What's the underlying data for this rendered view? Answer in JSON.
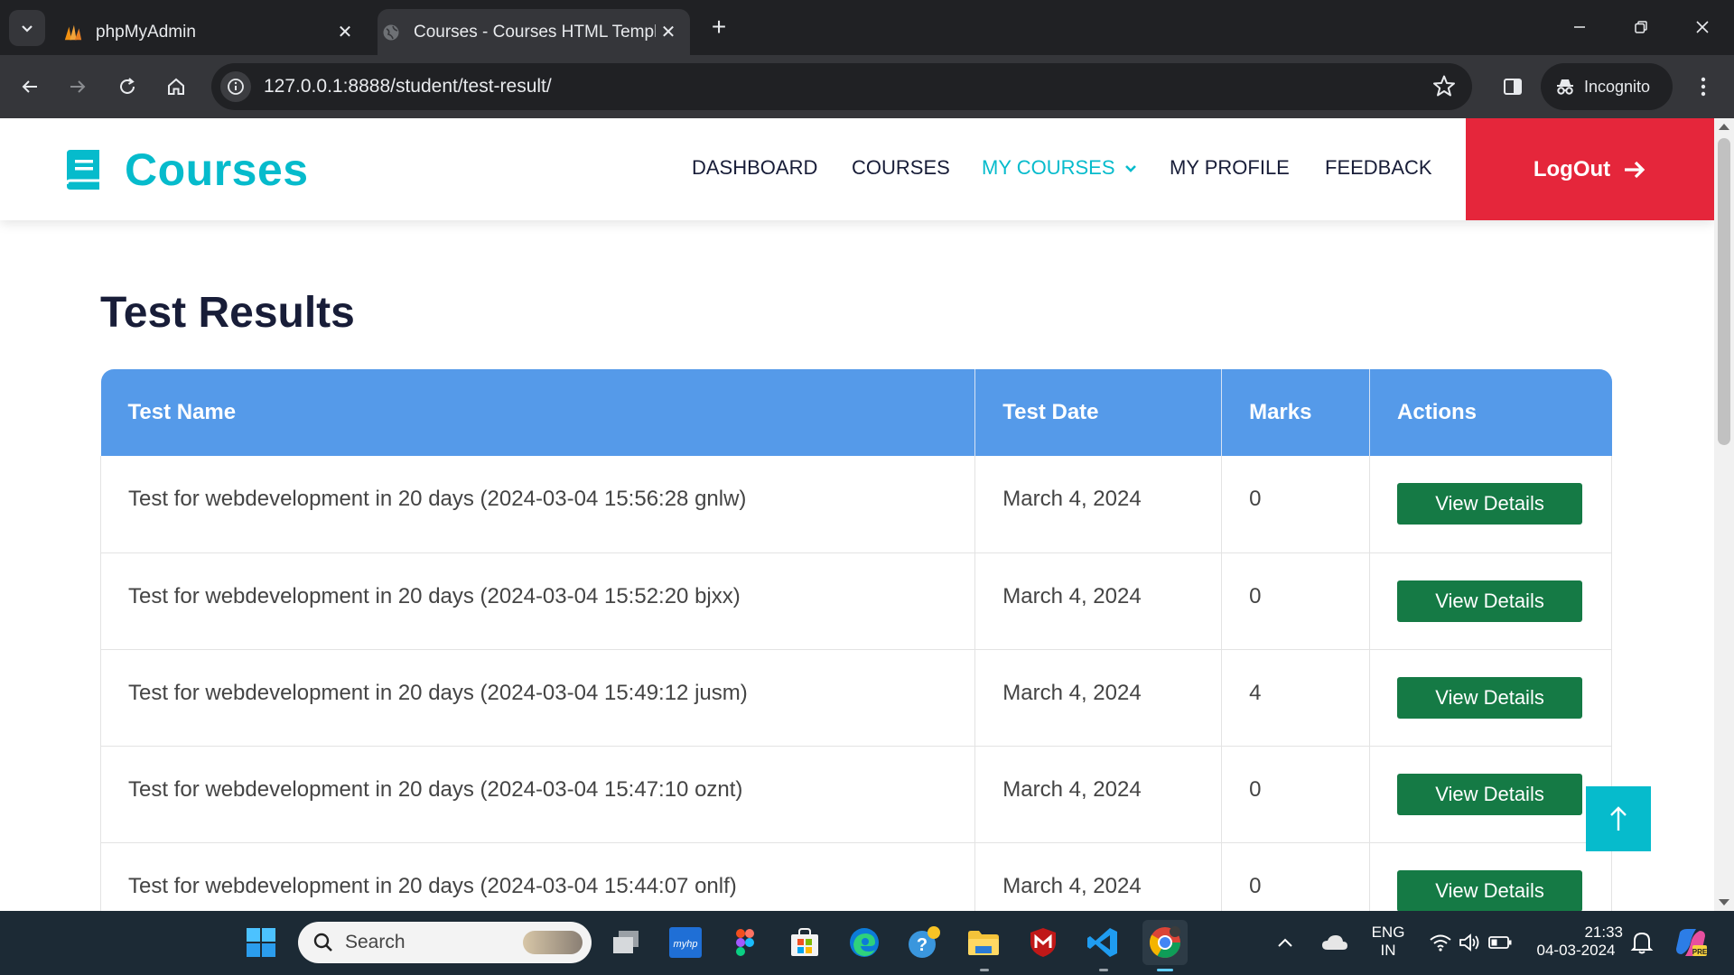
{
  "browser": {
    "tabs": [
      {
        "title": "phpMyAdmin",
        "active": false
      },
      {
        "title": "Courses - Courses HTML Template",
        "active": true
      }
    ],
    "url": "127.0.0.1:8888/student/test-result/",
    "profile_label": "Incognito"
  },
  "site": {
    "brand": "Courses",
    "nav": [
      {
        "label": "DASHBOARD",
        "active": false
      },
      {
        "label": "COURSES",
        "active": false
      },
      {
        "label": "MY COURSES",
        "active": true,
        "has_dropdown": true
      },
      {
        "label": "MY PROFILE",
        "active": false
      },
      {
        "label": "FEEDBACK",
        "active": false
      }
    ],
    "logout_label": "LogOut",
    "accent_color": "#06bbcc",
    "logout_color": "#e5263b"
  },
  "page": {
    "title": "Test Results",
    "table": {
      "headers": [
        "Test Name",
        "Test Date",
        "Marks",
        "Actions"
      ],
      "header_color": "#559ae9",
      "rows": [
        {
          "name": "Test for webdevelopment in 20 days (2024-03-04 15:56:28 gnlw)",
          "date": "March 4, 2024",
          "marks": "0",
          "action": "View Details"
        },
        {
          "name": "Test for webdevelopment in 20 days (2024-03-04 15:52:20 bjxx)",
          "date": "March 4, 2024",
          "marks": "0",
          "action": "View Details"
        },
        {
          "name": "Test for webdevelopment in 20 days (2024-03-04 15:49:12 jusm)",
          "date": "March 4, 2024",
          "marks": "4",
          "action": "View Details"
        },
        {
          "name": "Test for webdevelopment in 20 days (2024-03-04 15:47:10 oznt)",
          "date": "March 4, 2024",
          "marks": "0",
          "action": "View Details"
        },
        {
          "name": "Test for webdevelopment in 20 days (2024-03-04 15:44:07 onlf)",
          "date": "March 4, 2024",
          "marks": "0",
          "action": "View Details"
        }
      ],
      "button_color": "#157a45"
    }
  },
  "taskbar": {
    "search_label": "Search",
    "language": "ENG",
    "region": "IN",
    "time": "21:33",
    "date": "04-03-2024"
  }
}
